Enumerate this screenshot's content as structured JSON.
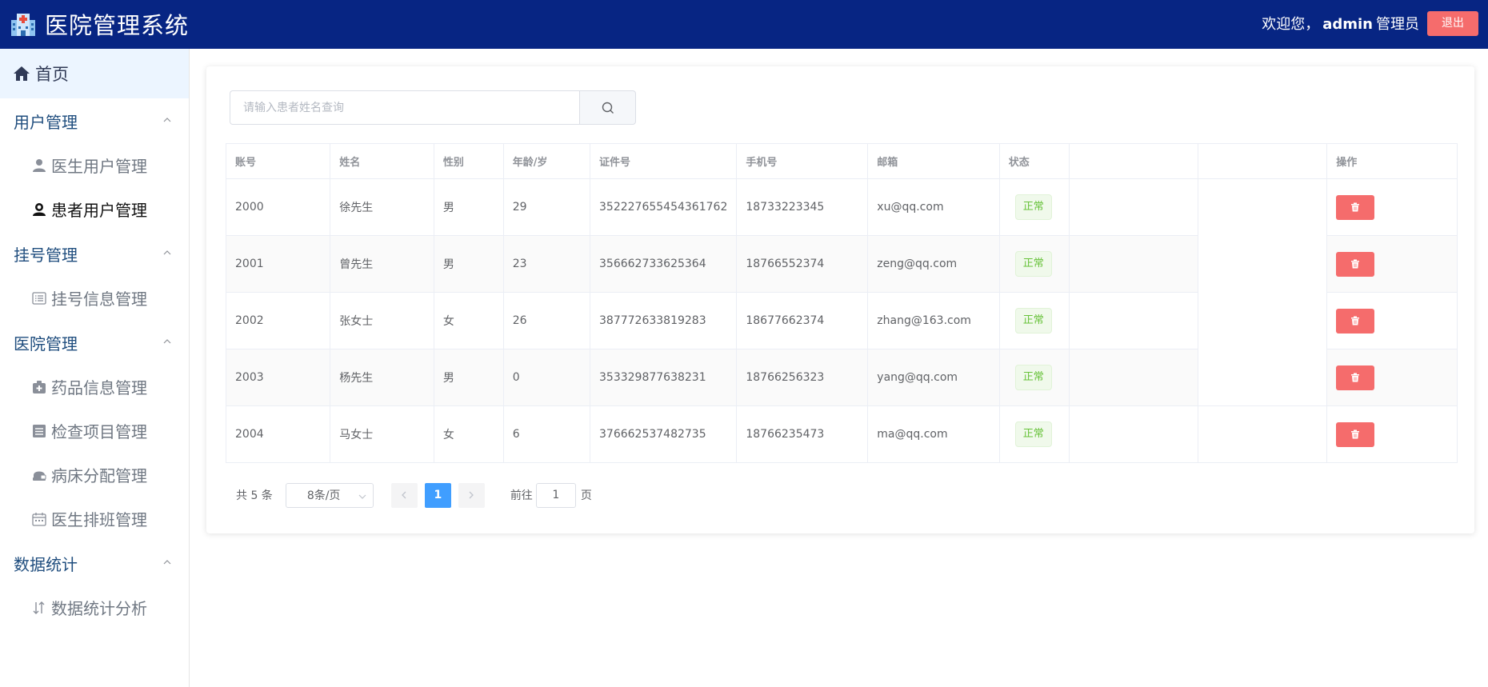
{
  "header": {
    "title": "医院管理系统",
    "welcome_prefix": "欢迎您，",
    "username": "admin",
    "role": "管理员",
    "logout_label": "退出"
  },
  "sidebar": {
    "home_label": "首页",
    "groups": [
      {
        "title": "用户管理",
        "items": [
          {
            "label": "医生用户管理",
            "icon": "doctor-user-icon"
          },
          {
            "label": "患者用户管理",
            "icon": "patient-user-icon",
            "active": true
          }
        ]
      },
      {
        "title": "挂号管理",
        "items": [
          {
            "label": "挂号信息管理",
            "icon": "list-icon"
          }
        ]
      },
      {
        "title": "医院管理",
        "items": [
          {
            "label": "药品信息管理",
            "icon": "medicine-box-icon"
          },
          {
            "label": "检查项目管理",
            "icon": "document-icon"
          },
          {
            "label": "病床分配管理",
            "icon": "bed-icon"
          },
          {
            "label": "医生排班管理",
            "icon": "calendar-icon"
          }
        ]
      },
      {
        "title": "数据统计",
        "items": [
          {
            "label": "数据统计分析",
            "icon": "sort-icon"
          }
        ]
      }
    ]
  },
  "search": {
    "placeholder": "请输入患者姓名查询"
  },
  "table": {
    "columns": [
      "账号",
      "姓名",
      "性别",
      "年龄/岁",
      "证件号",
      "手机号",
      "邮箱",
      "状态",
      "",
      "",
      "操作"
    ],
    "rows": [
      {
        "account": "2000",
        "name": "徐先生",
        "gender": "男",
        "age": "29",
        "id_no": "352227655454361762",
        "phone": "18733223345",
        "email": "xu@qq.com",
        "status": "正常"
      },
      {
        "account": "2001",
        "name": "曾先生",
        "gender": "男",
        "age": "23",
        "id_no": "356662733625364",
        "phone": "18766552374",
        "email": "zeng@qq.com",
        "status": "正常"
      },
      {
        "account": "2002",
        "name": "张女士",
        "gender": "女",
        "age": "26",
        "id_no": "387772633819283",
        "phone": "18677662374",
        "email": "zhang@163.com",
        "status": "正常"
      },
      {
        "account": "2003",
        "name": "杨先生",
        "gender": "男",
        "age": "0",
        "id_no": "353329877638231",
        "phone": "18766256323",
        "email": "yang@qq.com",
        "status": "正常"
      },
      {
        "account": "2004",
        "name": "马女士",
        "gender": "女",
        "age": "6",
        "id_no": "376662537482735",
        "phone": "18766235473",
        "email": "ma@qq.com",
        "status": "正常"
      }
    ]
  },
  "pagination": {
    "total_text": "共 5 条",
    "page_size": "8条/页",
    "current_page": "1",
    "goto_label": "前往",
    "goto_value": "1",
    "page_unit": "页"
  },
  "colors": {
    "header_bg": "#072583",
    "danger": "#f56c6c",
    "primary": "#409eff",
    "success": "#67c23a"
  }
}
